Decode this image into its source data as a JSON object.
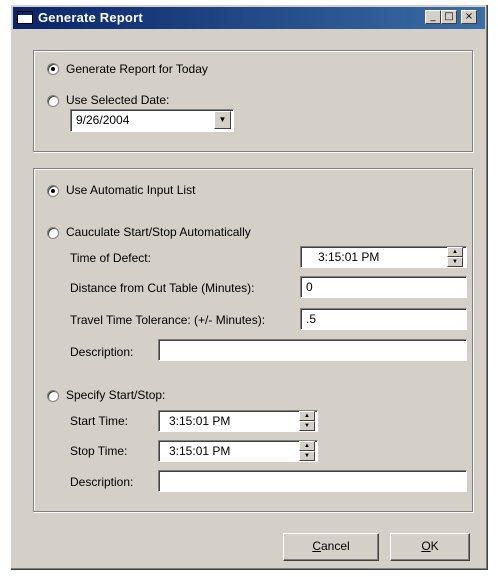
{
  "window": {
    "title": "Generate Report",
    "controls": {
      "minimize": "_",
      "maximize": "□",
      "close": "×"
    }
  },
  "date_group": {
    "today_option": "Generate Report for Today",
    "selected_date_option": "Use Selected Date:",
    "selected_date_value": "9/26/2004",
    "today_checked": true
  },
  "input_group": {
    "auto_option": "Use Automatic Input List",
    "calc_option": "Cauculate Start/Stop Automatically",
    "time_of_defect_label": "Time of Defect:",
    "time_of_defect_value": "3:15:01 PM",
    "distance_label": "Distance from Cut Table (Minutes):",
    "distance_value": "0",
    "tolerance_label": "Travel Time Tolerance: (+/- Minutes):",
    "tolerance_value": ".5",
    "calc_description_label": "Description:",
    "calc_description_value": "",
    "specify_option": "Specify Start/Stop:",
    "start_time_label": "Start Time:",
    "start_time_value": "3:15:01 PM",
    "stop_time_label": "Stop Time:",
    "stop_time_value": "3:15:01 PM",
    "specify_description_label": "Description:",
    "specify_description_value": ""
  },
  "buttons": {
    "cancel_underline": "C",
    "cancel_rest": "ancel",
    "ok_underline": "O",
    "ok_rest": "K"
  }
}
